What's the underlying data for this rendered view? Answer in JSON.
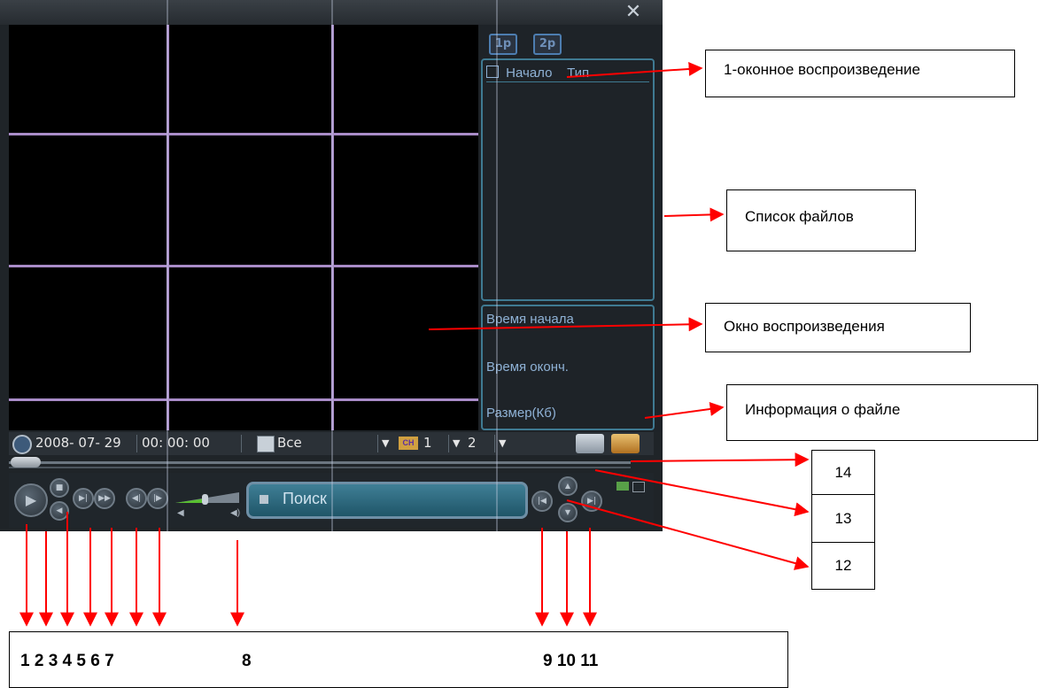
{
  "window": {
    "close_icon": "close-icon",
    "panel": {
      "btn_1p": "1p",
      "btn_2p": "2p",
      "file_header_start": "Начало",
      "file_header_type": "Тип",
      "start_time_label": "Время начала",
      "end_time_label": "Время оконч.",
      "size_label": "Размер(Кб)"
    },
    "toolbar": {
      "date": "2008- 07- 29",
      "time": "00: 00: 00",
      "record_type": "Все",
      "channel_1": "1",
      "channel_2": "2",
      "ch_badge": "CH"
    },
    "controls": {
      "search_label": "Поиск"
    }
  },
  "callouts": {
    "single_playback": "1-оконное воспроизведение",
    "file_list": "Список файлов",
    "playback_window": "Окно воспроизведения",
    "file_info": "Информация о файле",
    "n14": "14",
    "n13": "13",
    "n12": "12"
  },
  "bottom_numbers": {
    "g1": "1 2 3 4 5  6 7",
    "g2": "8",
    "g3": "9 10 11"
  },
  "colors": {
    "grid_line": "#a98cc8",
    "panel_border": "#3f7a92",
    "arrow": "#ff0000"
  }
}
